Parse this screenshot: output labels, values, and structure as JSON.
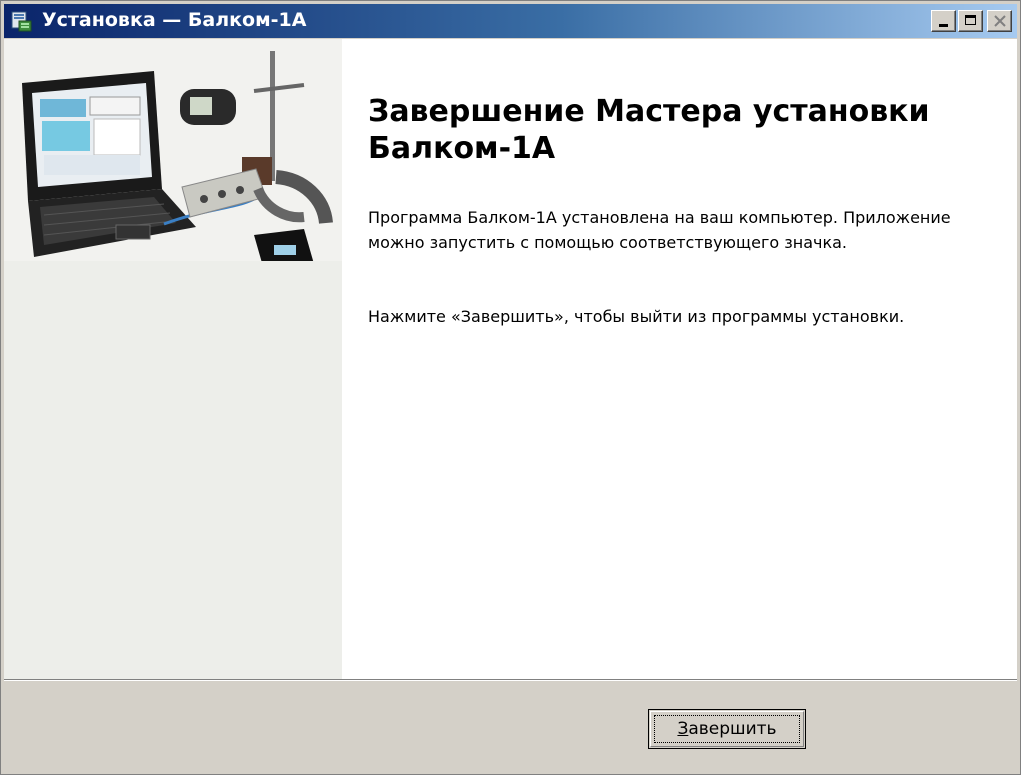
{
  "window": {
    "title": "Установка — Балком-1А",
    "controls": [
      "minimize-icon",
      "maximize-icon",
      "close-icon"
    ]
  },
  "wizard": {
    "heading": "Завершение Мастера установки Балком-1А",
    "paragraph1": "Программа Балком-1А установлена на ваш компьютер. Приложение можно запустить с помощью соответствующего значка.",
    "paragraph2": "Нажмите «Завершить», чтобы выйти из программы установки.",
    "side_image": "netbook-with-measuring-devices-photo"
  },
  "buttons": {
    "finish_mnemonic": "З",
    "finish_rest": "авершить"
  },
  "colors": {
    "titlebar_start": "#0a246a",
    "titlebar_end": "#a6caf0",
    "face": "#d4d0c8",
    "content_bg": "#ffffff",
    "sidepanel_bg": "#edeeea"
  }
}
